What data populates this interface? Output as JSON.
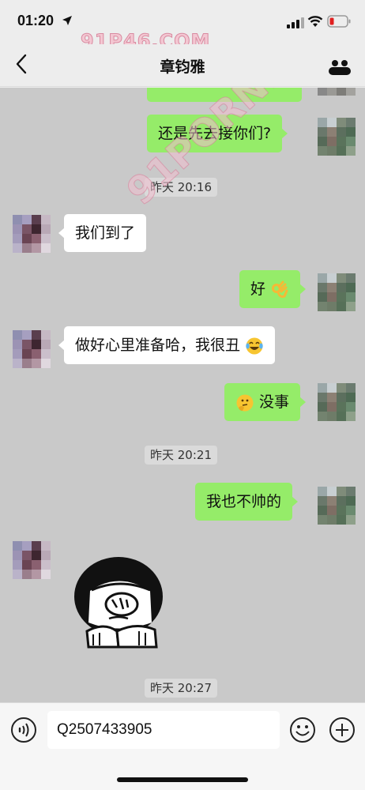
{
  "status_bar": {
    "time": "01:20",
    "battery_color": "#e02020"
  },
  "nav": {
    "title": "章钧雅"
  },
  "watermarks": {
    "top": "91P46.COM",
    "diagonal": "91PORN.COM"
  },
  "messages": [
    {
      "type": "text",
      "direction": "out",
      "text": "",
      "note": "partially visible bubble"
    },
    {
      "type": "text",
      "direction": "out",
      "text": "还是先去接你们?"
    },
    {
      "type": "timestamp",
      "text": "昨天 20:16"
    },
    {
      "type": "text",
      "direction": "in",
      "text": "我们到了"
    },
    {
      "type": "text",
      "direction": "out",
      "text": "好",
      "emoji": "ok-hand-emoji"
    },
    {
      "type": "text",
      "direction": "in",
      "text": "做好心里准备哈，我很丑",
      "emoji": "laughing-crying-emoji"
    },
    {
      "type": "text",
      "direction": "out",
      "text": "没事",
      "emoji_before": "thinking-face-emoji"
    },
    {
      "type": "timestamp",
      "text": "昨天 20:21"
    },
    {
      "type": "text",
      "direction": "out",
      "text": "我也不帅的"
    },
    {
      "type": "sticker",
      "direction": "in",
      "sticker": "facepalm-sticker"
    },
    {
      "type": "timestamp",
      "text": "昨天 20:27"
    }
  ],
  "input_bar": {
    "value": "Q2507433905"
  },
  "colors": {
    "outgoing_bubble": "#95ec69",
    "incoming_bubble": "#ffffff",
    "chat_background": "#c9c9c9"
  }
}
